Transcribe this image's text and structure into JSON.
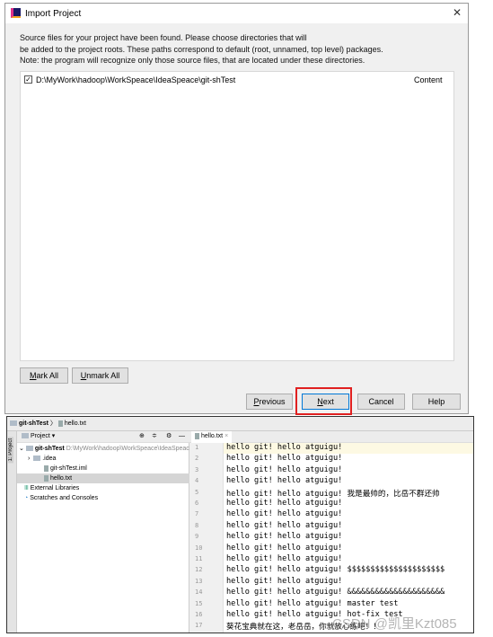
{
  "dialog": {
    "title": "Import Project",
    "description": [
      "Source files for your project have been found. Please choose directories that will",
      "be added to the project roots. These paths correspond to default (root, unnamed, top level) packages.",
      "Note: the program will recognize only those source files, that are located under these directories."
    ],
    "roots": [
      {
        "checked": true,
        "path": "D:\\MyWork\\hadoop\\WorkSpeace\\IdeaSpeace\\git-shTest",
        "type": "Content"
      }
    ],
    "mark_all": {
      "mnemonic": "M",
      "rest": "ark All"
    },
    "unmark_all": {
      "mnemonic": "U",
      "rest": "nmark All"
    },
    "previous": {
      "mnemonic": "P",
      "rest": "revious"
    },
    "next": {
      "mnemonic": "N",
      "rest": "ext"
    },
    "cancel": "Cancel",
    "help": "Help",
    "highlight_color": "#e02020"
  },
  "ide": {
    "breadcrumb": [
      "git-shTest",
      "hello.txt"
    ],
    "side_tab": "1: Project",
    "project_panel": {
      "title": "Project ▾",
      "tree": [
        {
          "label": "git-shTest",
          "extra": "D:\\MyWork\\hadoop\\WorkSpeace\\IdeaSpeace",
          "indent": 0,
          "kind": "module"
        },
        {
          "label": ".idea",
          "indent": 1,
          "kind": "folder"
        },
        {
          "label": "git-shTest.iml",
          "indent": 2,
          "kind": "file"
        },
        {
          "label": "hello.txt",
          "indent": 2,
          "kind": "file",
          "selected": true
        },
        {
          "label": "External Libraries",
          "indent": 0,
          "kind": "lib"
        },
        {
          "label": "Scratches and Consoles",
          "indent": 0,
          "kind": "scratch"
        }
      ]
    },
    "editor_tab": "hello.txt",
    "lines": [
      "hello git! hello atguigu!",
      "hello git! hello atguigu!",
      "hello git! hello atguigu!",
      "hello git! hello atguigu!",
      "hello git! hello atguigu! 我是最帅的，比岳不群还帅",
      "hello git! hello atguigu!",
      "hello git! hello atguigu!",
      "hello git! hello atguigu!",
      "hello git! hello atguigu!",
      "hello git! hello atguigu!",
      "hello git! hello atguigu!",
      "hello git! hello atguigu! $$$$$$$$$$$$$$$$$$$$$",
      "hello git! hello atguigu!",
      "hello git! hello atguigu! &&&&&&&&&&&&&&&&&&&&&",
      "hello git! hello atguigu! master test",
      "hello git! hello atguigu! hot-fix test",
      "葵花宝典就在这，老岳岳，你就放心练吧！！"
    ]
  },
  "watermark": "CSDN @凯里Kzt085"
}
